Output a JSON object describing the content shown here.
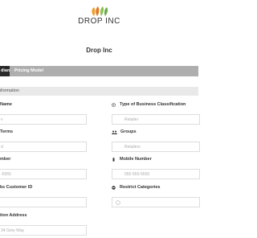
{
  "header": {
    "logo_text": "DROP INC",
    "page_title": "Drop Inc"
  },
  "tabs": [
    {
      "label": "dian"
    },
    {
      "label": "Pricing Model"
    }
  ],
  "section": {
    "title": "nformation"
  },
  "fields": {
    "name": {
      "label": "Name",
      "placeholder": "v"
    },
    "business_type": {
      "label": "Type of Business Classification",
      "placeholder": "Retailer"
    },
    "terms": {
      "label": "Terms",
      "placeholder": ""
    },
    "groups": {
      "label": "Groups",
      "placeholder": "Retailers"
    },
    "phone": {
      "label": "mber",
      "placeholder": "-5555"
    },
    "mobile": {
      "label": "Mobile Number",
      "placeholder": "555-555-5555"
    },
    "qb_customer": {
      "label": "ks Customer ID",
      "placeholder": ""
    },
    "restrict": {
      "label": "Restrict Categories",
      "placeholder": ""
    },
    "location": {
      "label": "tion Address",
      "placeholder": "34 Grey Way"
    }
  },
  "colors": {
    "tab_bar": "#aeaeae",
    "tab_active": "#2a2a2a",
    "section_bg": "#e9e9e9",
    "leaf_orange": "#f0a030",
    "leaf_green": "#8bc34a"
  }
}
